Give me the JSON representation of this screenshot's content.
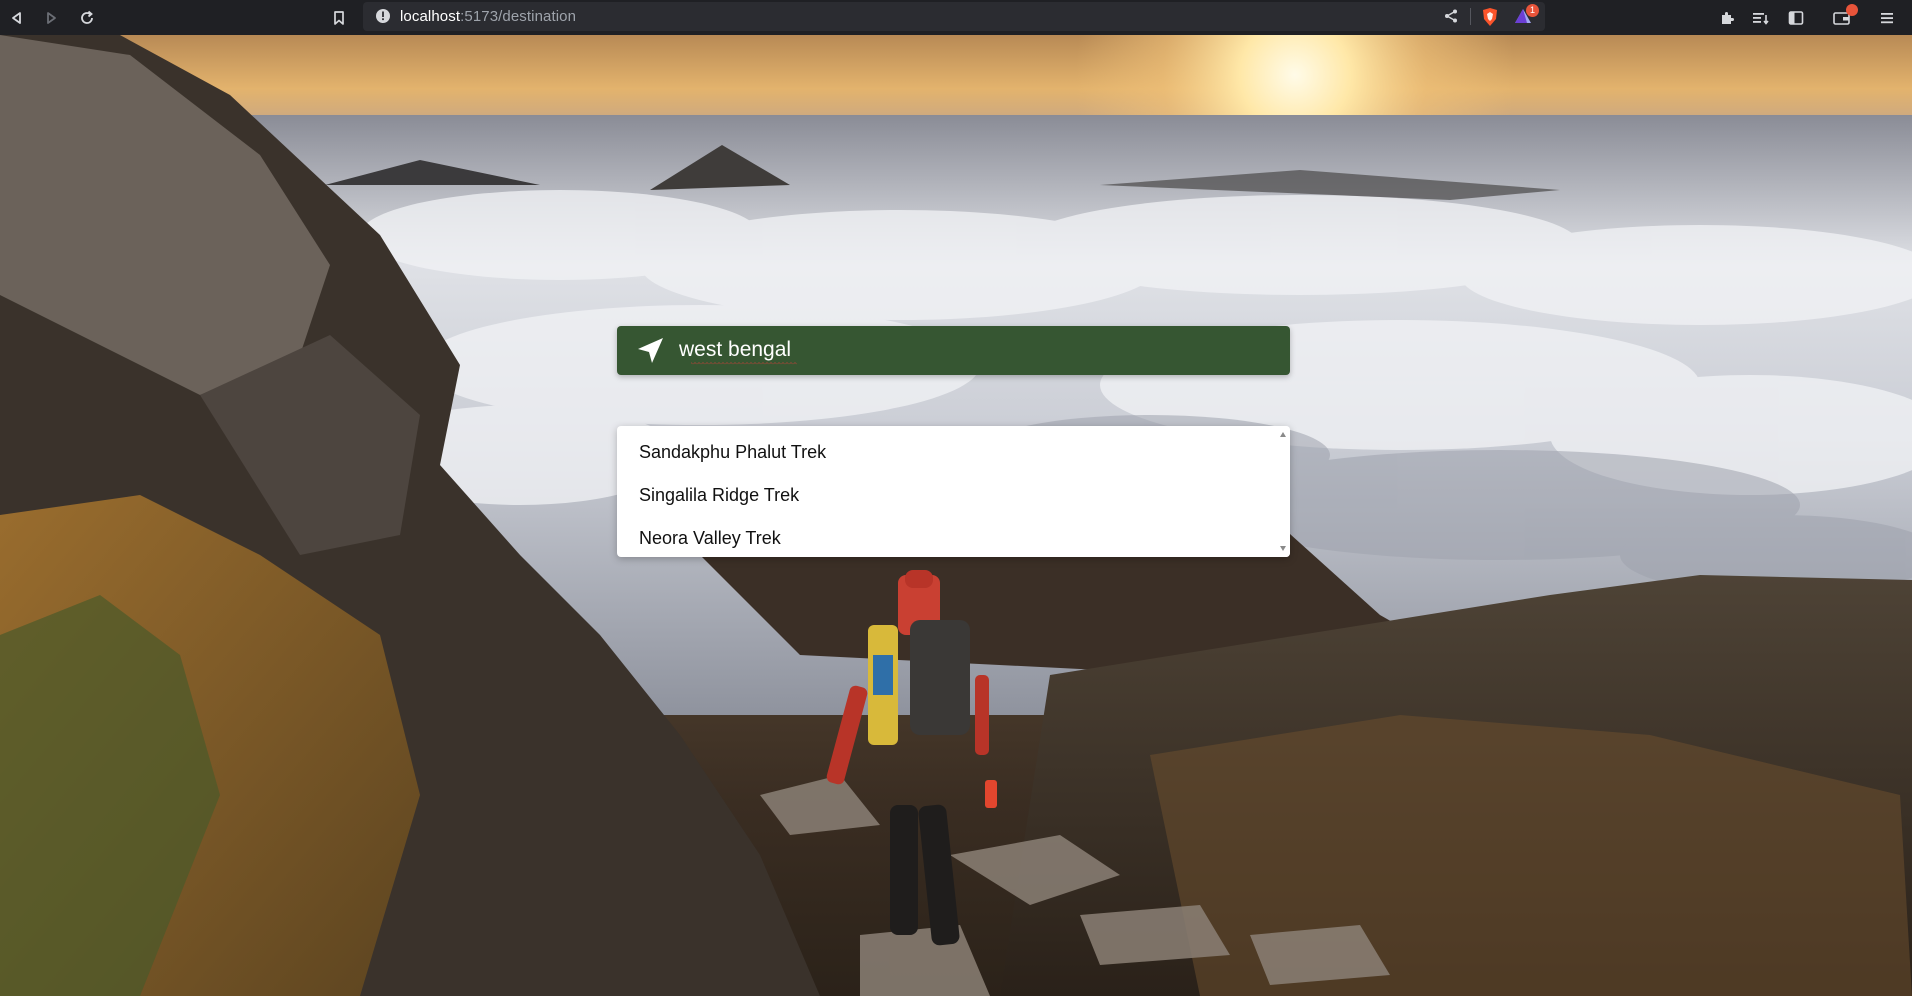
{
  "browser": {
    "url_host": "localhost",
    "url_path": ":5173/destination",
    "rewards_badge": "1",
    "icons": [
      "back-icon",
      "forward-icon",
      "reload-icon",
      "bookmark-icon",
      "site-info-icon",
      "share-icon",
      "brave-shields-icon",
      "brave-rewards-icon",
      "extensions-icon",
      "reading-list-icon",
      "sidebar-icon",
      "wallet-icon",
      "menu-icon"
    ]
  },
  "search": {
    "value": "west bengal",
    "icon": "paper-plane-icon",
    "bar_color": "#365632"
  },
  "suggestions": [
    {
      "label": "Sandakphu Phalut Trek"
    },
    {
      "label": "Singalila Ridge Trek"
    },
    {
      "label": "Neora Valley Trek"
    }
  ]
}
